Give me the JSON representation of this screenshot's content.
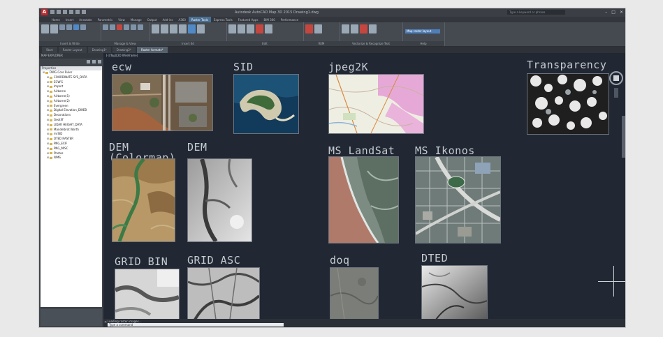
{
  "titlebar": {
    "logo": "A",
    "title": "Autodesk AutoCAD Map 3D 2015  Drawing1.dwg",
    "search_placeholder": "Type a keyword or phrase",
    "minimize": "–",
    "maximize": "□",
    "close": "✕"
  },
  "ribbon_tabs": [
    {
      "label": "Home",
      "active": false
    },
    {
      "label": "Insert",
      "active": false
    },
    {
      "label": "Annotate",
      "active": false
    },
    {
      "label": "Parametric",
      "active": false
    },
    {
      "label": "View",
      "active": false
    },
    {
      "label": "Manage",
      "active": false
    },
    {
      "label": "Output",
      "active": false
    },
    {
      "label": "Add-ins",
      "active": false
    },
    {
      "label": "A360",
      "active": false
    },
    {
      "label": "Raster Tools",
      "active": true
    },
    {
      "label": "Express Tools",
      "active": false
    },
    {
      "label": "Featured Apps",
      "active": false
    },
    {
      "label": "BIM 360",
      "active": false
    },
    {
      "label": "Performance",
      "active": false
    }
  ],
  "ribbon_panels": [
    {
      "label": "Insert & Write"
    },
    {
      "label": "Manage & View"
    },
    {
      "label": "Insert Ed"
    },
    {
      "label": "Edit"
    },
    {
      "label": "REM"
    },
    {
      "label": "Vectorize & Recognize Text"
    },
    {
      "label": "Help"
    }
  ],
  "ribbon_dropdown": "Map raster layout",
  "file_tabs": [
    {
      "label": "Start",
      "active": false
    },
    {
      "label": "Raster Layout",
      "active": false
    },
    {
      "label": "Drawing1*",
      "active": false
    },
    {
      "label": "Drawing2*",
      "active": false
    },
    {
      "label": "Raster formats*",
      "active": true
    }
  ],
  "explorer": {
    "title": "MAP EXPLORER",
    "tree_header": "Properties",
    "items": [
      "DWG Core Ruler",
      "COORDINATE SYS_DATA",
      "ECW'S",
      "Import",
      "Airborne",
      "Airborne(1)",
      "Airborne(2)",
      "Evergreen",
      "Digital Elevation_DWEB",
      "Decorations",
      "Geotiff",
      "LIDAR HEIGHT_DATA",
      "Mandelbrot Worth",
      "mrSID",
      "DTED RASTER",
      "PNG_EXIF",
      "PNG_MISC",
      "Photos",
      "WMS"
    ]
  },
  "canvas": {
    "viewport_label": "[-][Top][2D Wireframe]",
    "labels": {
      "ecw": "ecw",
      "sid": "SID",
      "jpeg2k": "jpeg2K",
      "transparency": "Transparency",
      "dem_colormap": "DEM",
      "dem_colormap_sub": "(Colormap)",
      "dem": "DEM",
      "ms_landsat": "MS LandSat",
      "ms_ikonos": "MS Ikonos",
      "grid_bin": "GRID BIN",
      "grid_asc": "GRID ASC",
      "doq": "doq",
      "dted": "DTED"
    }
  },
  "command_line": {
    "history": "Loading raster images...",
    "current": "Type a command"
  },
  "colors": {
    "canvas_bg": "#212833",
    "ribbon_bg": "#454a51",
    "active_tab": "#4a6f93"
  }
}
